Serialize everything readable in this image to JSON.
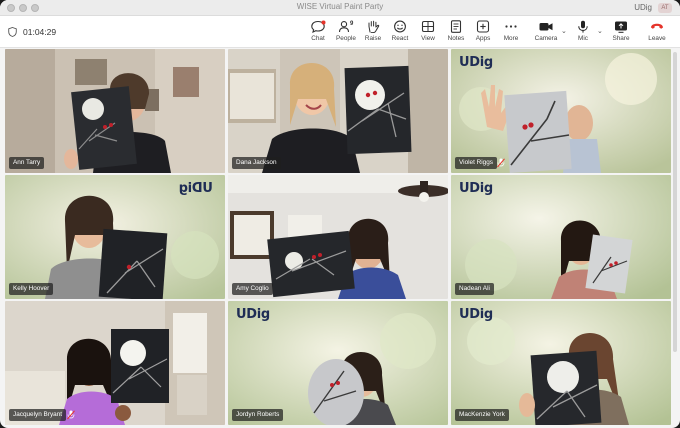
{
  "window": {
    "title": "WISE Virtual Paint Party",
    "user_name": "UDig",
    "avatar_initials": "AT"
  },
  "toolbar": {
    "timer": "01:04:29",
    "participant_count": "9",
    "buttons": [
      {
        "label": "Chat",
        "icon": "chat-icon"
      },
      {
        "label": "People",
        "icon": "people-icon"
      },
      {
        "label": "Raise",
        "icon": "raise-hand-icon"
      },
      {
        "label": "React",
        "icon": "react-icon"
      },
      {
        "label": "View",
        "icon": "view-icon"
      },
      {
        "label": "Notes",
        "icon": "notes-icon"
      },
      {
        "label": "Apps",
        "icon": "apps-icon"
      },
      {
        "label": "More",
        "icon": "more-icon"
      },
      {
        "label": "Camera",
        "icon": "camera-icon"
      },
      {
        "label": "Mic",
        "icon": "mic-icon"
      },
      {
        "label": "Share",
        "icon": "share-icon"
      },
      {
        "label": "Leave",
        "icon": "leave-icon"
      }
    ]
  },
  "participants": [
    {
      "name": "Ann Tarry",
      "muted": false,
      "logo": ""
    },
    {
      "name": "Dana Jackson",
      "muted": false,
      "logo": ""
    },
    {
      "name": "Violet Riggs",
      "muted": true,
      "logo": "UDig"
    },
    {
      "name": "Kelly Hoover",
      "muted": false,
      "logo": "UDig"
    },
    {
      "name": "Amy Coglio",
      "muted": false,
      "logo": ""
    },
    {
      "name": "Nadean Ali",
      "muted": false,
      "logo": "UDig"
    },
    {
      "name": "Jacquelyn Bryant",
      "muted": true,
      "logo": ""
    },
    {
      "name": "Jordyn Roberts",
      "muted": false,
      "logo": "UDig"
    },
    {
      "name": "MacKenzie York",
      "muted": false,
      "logo": "UDig"
    }
  ],
  "colors": {
    "leave_red": "#e5332a",
    "logo_navy": "#1f2d55",
    "bird_red": "#c0202a"
  }
}
